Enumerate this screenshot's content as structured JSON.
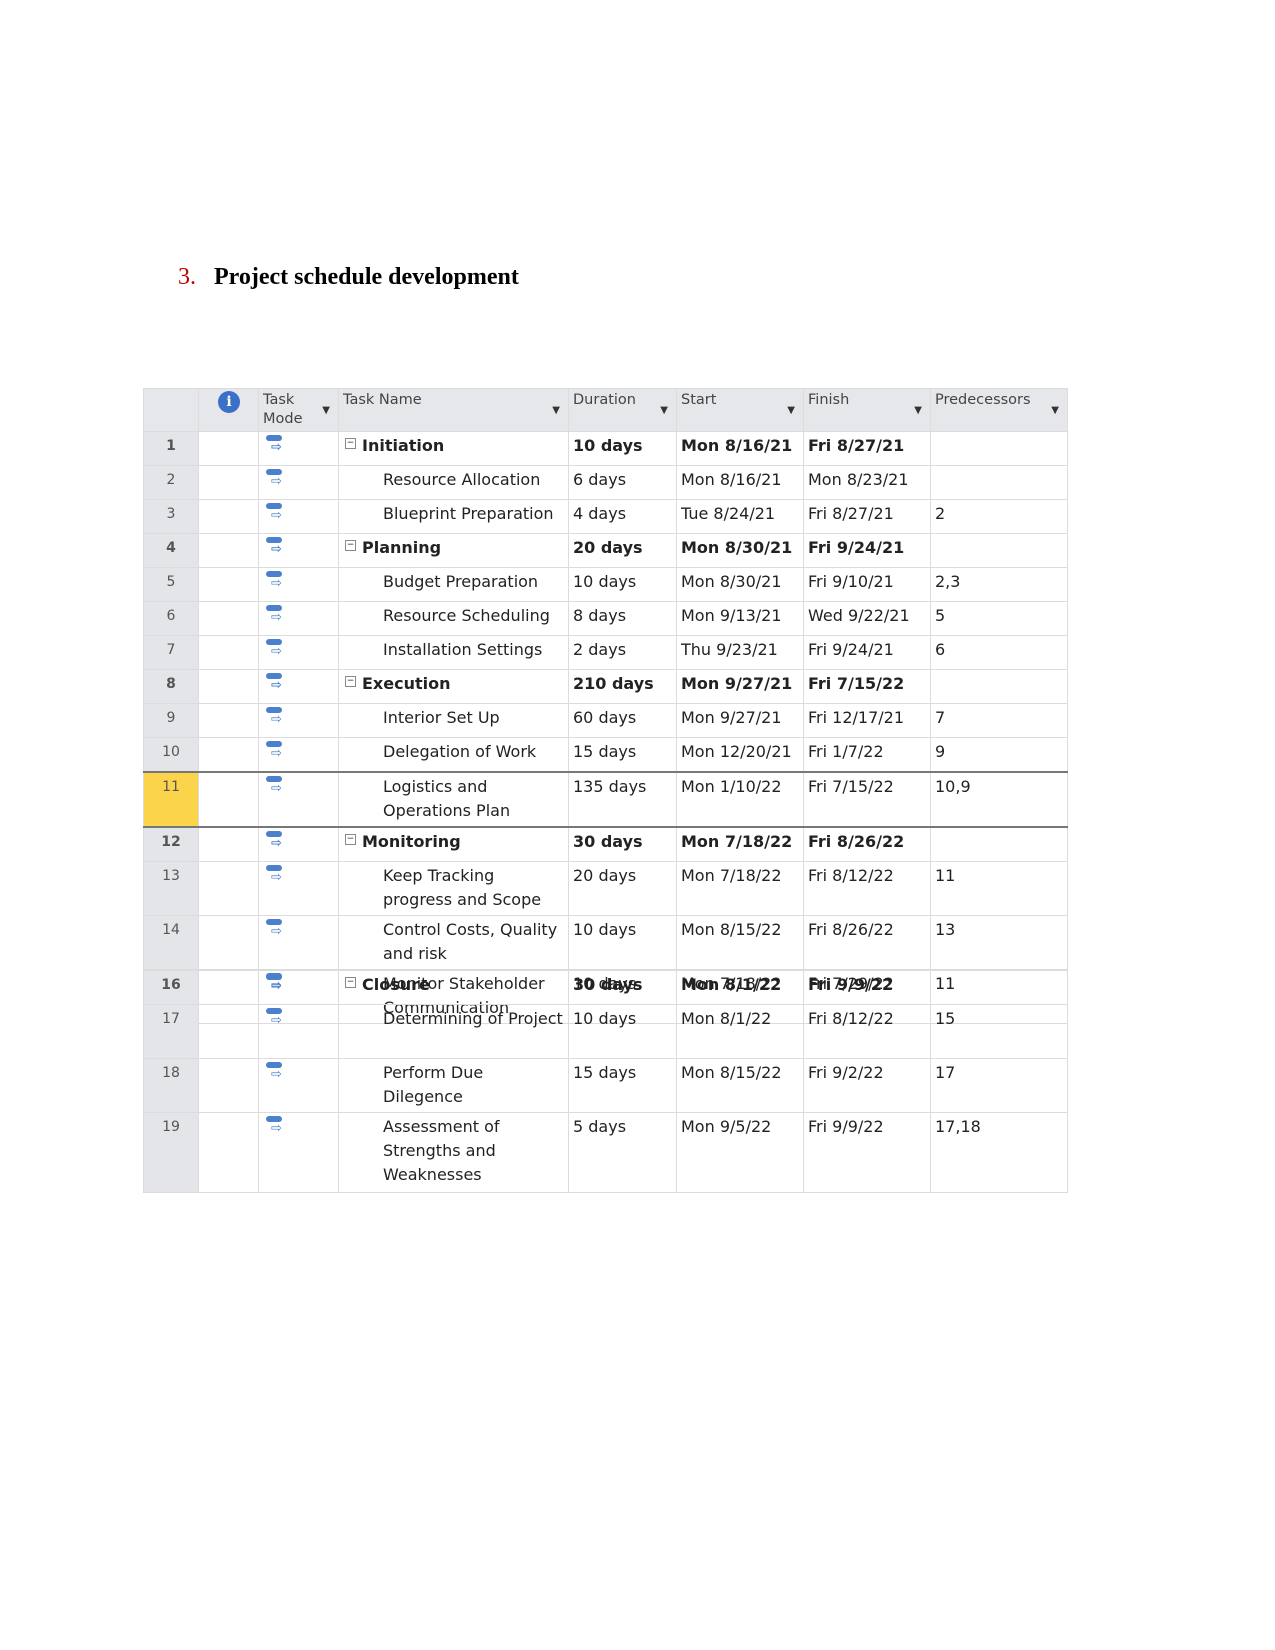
{
  "heading": {
    "number": "3.",
    "title": "Project schedule development"
  },
  "columns": {
    "task_mode": "Task Mode",
    "task_name": "Task Name",
    "duration": "Duration",
    "start": "Start",
    "finish": "Finish",
    "predecessors": "Predecessors"
  },
  "icons": {
    "info": "info-icon",
    "mode": "auto-scheduled-task-icon",
    "collapse": "collapse-minus-icon",
    "dropdown": "dropdown-arrow-icon"
  },
  "colors": {
    "selected_row": "#fbd44b",
    "info": "#3a70c8"
  },
  "rows": [
    {
      "id": "1",
      "name": "Initiation",
      "duration": "10 days",
      "start": "Mon 8/16/21",
      "finish": "Fri 8/27/21",
      "pred": "",
      "summary": true
    },
    {
      "id": "2",
      "name": "Resource Allocation",
      "duration": "6 days",
      "start": "Mon 8/16/21",
      "finish": "Mon 8/23/21",
      "pred": ""
    },
    {
      "id": "3",
      "name": "Blueprint Preparation",
      "duration": "4 days",
      "start": "Tue 8/24/21",
      "finish": "Fri 8/27/21",
      "pred": "2"
    },
    {
      "id": "4",
      "name": "Planning",
      "duration": "20 days",
      "start": "Mon 8/30/21",
      "finish": "Fri 9/24/21",
      "pred": "",
      "summary": true
    },
    {
      "id": "5",
      "name": "Budget Preparation",
      "duration": "10 days",
      "start": "Mon 8/30/21",
      "finish": "Fri 9/10/21",
      "pred": "2,3"
    },
    {
      "id": "6",
      "name": "Resource Scheduling",
      "duration": "8 days",
      "start": "Mon 9/13/21",
      "finish": "Wed 9/22/21",
      "pred": "5"
    },
    {
      "id": "7",
      "name": "Installation Settings",
      "duration": "2 days",
      "start": "Thu 9/23/21",
      "finish": "Fri 9/24/21",
      "pred": "6"
    },
    {
      "id": "8",
      "name": "Execution",
      "duration": "210 days",
      "start": "Mon 9/27/21",
      "finish": "Fri 7/15/22",
      "pred": "",
      "summary": true
    },
    {
      "id": "9",
      "name": "Interior Set Up",
      "duration": "60 days",
      "start": "Mon 9/27/21",
      "finish": "Fri 12/17/21",
      "pred": "7"
    },
    {
      "id": "10",
      "name": "Delegation of Work",
      "duration": "15 days",
      "start": "Mon 12/20/21",
      "finish": "Fri 1/7/22",
      "pred": "9"
    },
    {
      "id": "11",
      "name": "Logistics and Operations Plan",
      "duration": "135 days",
      "start": "Mon 1/10/22",
      "finish": "Fri 7/15/22",
      "pred": "10,9",
      "selected": true
    },
    {
      "id": "12",
      "name": "Monitoring",
      "duration": "30 days",
      "start": "Mon 7/18/22",
      "finish": "Fri 8/26/22",
      "pred": "",
      "summary": true
    },
    {
      "id": "13",
      "name": "Keep Tracking progress and Scope",
      "duration": "20 days",
      "start": "Mon 7/18/22",
      "finish": "Fri 8/12/22",
      "pred": "11"
    },
    {
      "id": "14",
      "name": "Control Costs, Quality and risk",
      "duration": "10 days",
      "start": "Mon 8/15/22",
      "finish": "Fri 8/26/22",
      "pred": "13"
    },
    {
      "id": "15",
      "name": "Monitor Stakeholder Communication",
      "duration": "10 days",
      "start": "Mon 7/18/22",
      "finish": "Fri 7/29/22",
      "pred": "11"
    },
    {
      "id": "16",
      "name": "Closure",
      "duration": "30 days",
      "start": "Mon 8/1/22",
      "finish": "Fri 9/9/22",
      "pred": "",
      "summary": true
    },
    {
      "id": "17",
      "name": "Determining of Project",
      "duration": "10 days",
      "start": "Mon 8/1/22",
      "finish": "Fri 8/12/22",
      "pred": "15"
    },
    {
      "id": "18",
      "name": "Perform Due Dilegence",
      "duration": "15 days",
      "start": "Mon 8/15/22",
      "finish": "Fri 9/2/22",
      "pred": "17"
    },
    {
      "id": "19",
      "name": "Assessment of Strengths and Weaknesses",
      "duration": "5 days",
      "start": "Mon 9/5/22",
      "finish": "Fri 9/9/22",
      "pred": "17,18"
    }
  ]
}
